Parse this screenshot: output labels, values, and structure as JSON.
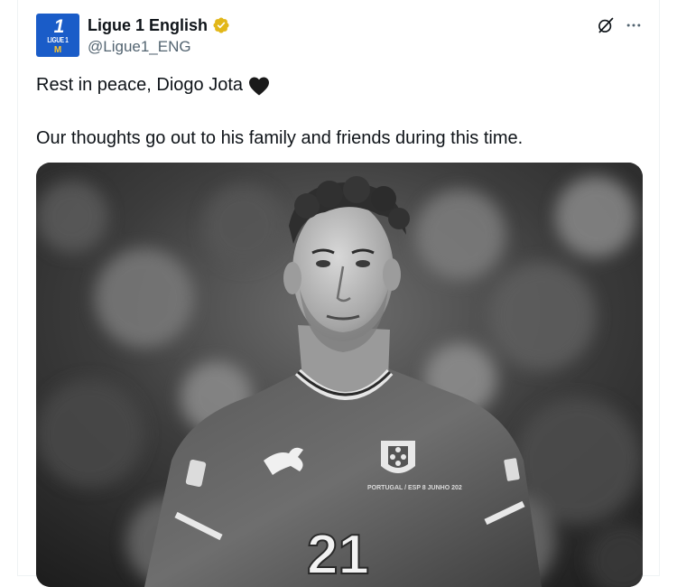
{
  "author": {
    "display_name": "Ligue 1 English",
    "handle": "@Ligue1_ENG",
    "verified": true,
    "avatar_icon": "ligue1-logo-icon",
    "avatar_text": {
      "number": "1",
      "brand": "LIGUE 1",
      "sponsor": "M"
    },
    "avatar_color": "#1a5cc8"
  },
  "header_actions": {
    "grok_icon": "grok-icon",
    "more_icon": "more-icon"
  },
  "tweet": {
    "line1": "Rest in peace, Diogo Jota",
    "line1_emoji": "black-heart-icon",
    "line2": "Our thoughts go out to his family and friends during this time."
  },
  "media": {
    "type": "photo",
    "style": "black-and-white",
    "jersey_number": "21",
    "jersey_print": "PORTUGAL / ESP 8 JUNHO 202"
  },
  "colors": {
    "text": "#0f1419",
    "secondary": "#536471",
    "verified_gold": "#e2b719",
    "border": "#eff3f4"
  }
}
